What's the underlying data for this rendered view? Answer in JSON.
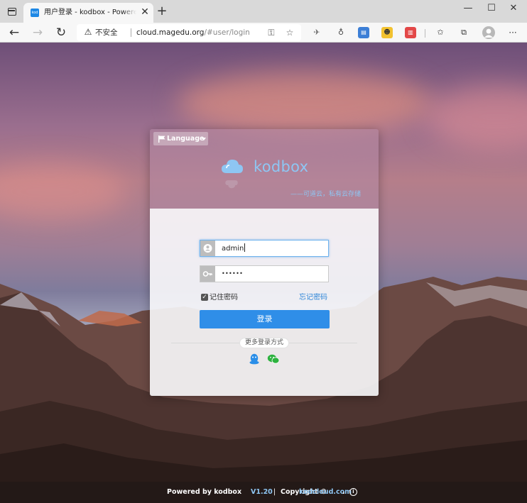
{
  "browser": {
    "tab_title": "用户登录 - kodbox - Powered by kodbox",
    "favicon_text": "kod",
    "tab_close": "✕",
    "new_tab": "+",
    "window": {
      "minimize": "—",
      "maximize": "☐",
      "close": "✕"
    },
    "security_label": "不安全",
    "url_host": "cloud.magedu.org",
    "url_path": "/#user/login",
    "menu": "···"
  },
  "card": {
    "language_label": "Language",
    "brand": "kodbox",
    "slogan": "——可道云，私有云存储"
  },
  "form": {
    "username_value": "admin",
    "password_value": "••••••",
    "remember_label": "记住密码",
    "remember_checked": true,
    "forgot_label": "忘记密码",
    "login_label": "登录",
    "more_login_label": "更多登录方式"
  },
  "footer": {
    "powered_text": "Powered by kodbox",
    "version": "V1.20",
    "sep": "|",
    "copyright_text": "Copyright ©",
    "copyright_link": "kodcloud.com",
    "period": ".",
    "info_icon": "i"
  },
  "colors": {
    "accent": "#2f8ee8",
    "brand": "#8ec6f3",
    "link": "#2e86d8"
  },
  "icons": [
    "tab-actions-icon",
    "back-arrow-icon",
    "forward-arrow-icon",
    "refresh-icon",
    "warning-icon",
    "key-icon",
    "favorite-add-icon",
    "reading-icon",
    "extension-icons",
    "favorites-icon",
    "collections-icon",
    "profile-avatar",
    "more-menu-icon",
    "flag-icon",
    "cloud-logo",
    "user-icon",
    "key-field-icon",
    "qq-icon",
    "wechat-icon",
    "info-icon"
  ]
}
